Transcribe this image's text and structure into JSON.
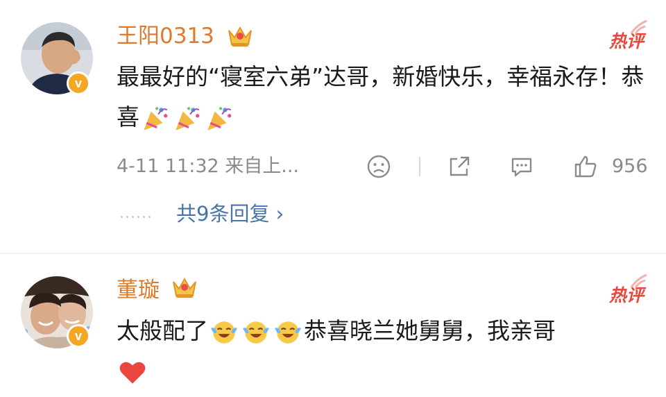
{
  "comments": [
    {
      "username": "王阳0313",
      "hot_label": "热评",
      "badge_letter": "v",
      "text_main": "最最好的“寝室六弟”达哥，新婚快乐，幸福永存！恭喜",
      "emojis": [
        "party-popper-emoji",
        "party-popper-emoji",
        "party-popper-emoji"
      ],
      "time_source": "4-11 11:32 来自上...",
      "like_count": "956",
      "replies_dots": "......",
      "replies_link": "共9条回复 ›"
    },
    {
      "username": "董璇",
      "hot_label": "热评",
      "badge_letter": "v",
      "text_before": "太般配了",
      "text_after": "恭喜晓兰她舅舅，我亲哥",
      "emojis": [
        "tears-of-joy-emoji",
        "tears-of-joy-emoji",
        "tears-of-joy-emoji",
        "red-heart-emoji"
      ]
    }
  ],
  "colors": {
    "username": "#e07a2b",
    "hot": "#e8473c",
    "link": "#4b73a8",
    "muted": "#8a8a8a",
    "badge": "#f5a623"
  }
}
